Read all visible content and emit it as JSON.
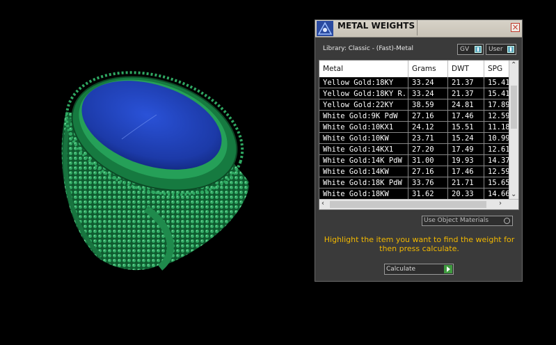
{
  "dialog": {
    "title": "METAL WEIGHTS",
    "close_symbol": "×",
    "library_label": "Library: Classic - (Fast)-Metal",
    "gv_label": "GV",
    "user_label": "User",
    "use_object_materials_label": "Use Object Materials",
    "instruction": "Highlight the item you want to find the weight for then press calculate.",
    "calculate_label": "Calculate"
  },
  "table": {
    "headers": [
      "Metal",
      "Grams",
      "DWT",
      "SPG"
    ],
    "rows": [
      [
        "Yellow Gold:18KY",
        "33.24",
        "21.37",
        "15.41"
      ],
      [
        "Yellow Gold:18KY R...",
        "33.24",
        "21.37",
        "15.41"
      ],
      [
        "Yellow Gold:22KY",
        "38.59",
        "24.81",
        "17.89"
      ],
      [
        "White Gold:9K PdW",
        "27.16",
        "17.46",
        "12.59"
      ],
      [
        "White Gold:10KX1",
        "24.12",
        "15.51",
        "11.18"
      ],
      [
        "White Gold:10KW",
        "23.71",
        "15.24",
        "10.99"
      ],
      [
        "White Gold:14KX1",
        "27.20",
        "17.49",
        "12.61"
      ],
      [
        "White Gold:14K PdW",
        "31.00",
        "19.93",
        "14.37"
      ],
      [
        "White Gold:14KW",
        "27.16",
        "17.46",
        "12.59"
      ],
      [
        "White Gold:18K PdW",
        "33.76",
        "21.71",
        "15.65"
      ],
      [
        "White Gold:18KW",
        "31.62",
        "20.33",
        "14.66"
      ]
    ]
  },
  "icons": {
    "title_icon": "app-triangle-icon",
    "close": "close-icon",
    "scroll_up": "chevron-up-icon",
    "scroll_down": "chevron-down-icon",
    "scroll_left": "chevron-left-icon",
    "scroll_right": "chevron-right-icon",
    "calculate_go": "play-arrow-icon"
  },
  "colors": {
    "instruction_text": "#f2b800",
    "ring_metal": "#1f8a4c",
    "ring_stone": "#1f3fb0",
    "calculate_go": "#3f9a3f"
  }
}
